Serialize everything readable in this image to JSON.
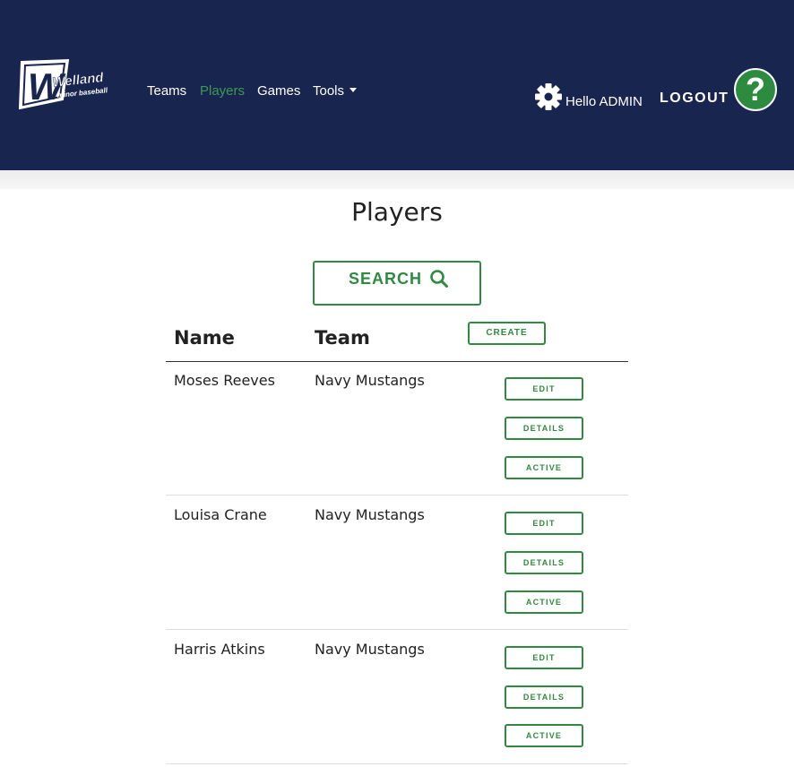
{
  "header": {
    "logo_word": "Welland",
    "logo_sub": "minor baseball",
    "nav": [
      "Teams",
      "Players",
      "Games",
      "Tools"
    ],
    "active_nav": "Players",
    "greeting": "Hello ADMIN",
    "logout_label": "LOGOUT",
    "help_label": "?"
  },
  "page": {
    "title": "Players",
    "search_label": "SEARCH"
  },
  "table": {
    "columns": [
      "Name",
      "Team"
    ],
    "create_label": "CREATE",
    "rows": [
      {
        "name": "Moses Reeves",
        "team": "Navy Mustangs"
      },
      {
        "name": "Louisa Crane",
        "team": "Navy Mustangs"
      },
      {
        "name": "Harris Atkins",
        "team": "Navy Mustangs"
      }
    ],
    "row_actions": [
      "EDIT",
      "DETAILS",
      "ACTIVE"
    ]
  },
  "colors": {
    "header_bg": "#18254f",
    "accent_green": "#2f8a3f",
    "active_nav": "#3c9b52"
  },
  "icons": [
    "gear-icon",
    "search-icon",
    "help-icon",
    "chevron-down-icon"
  ]
}
